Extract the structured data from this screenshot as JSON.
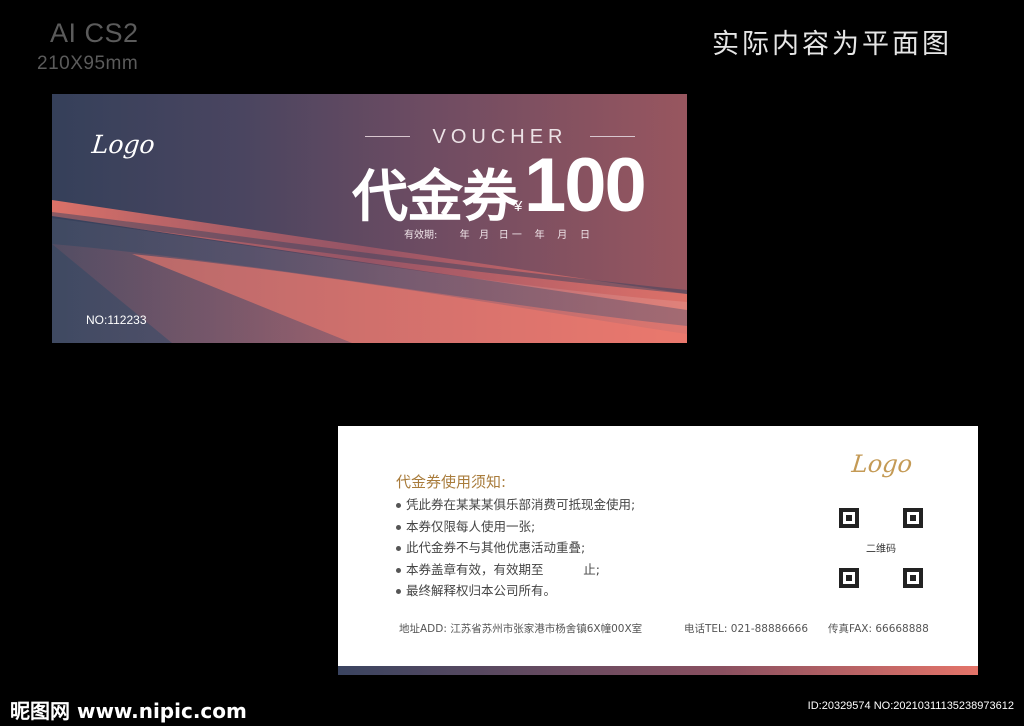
{
  "spec": {
    "software": "AI CS2",
    "size": "210X95mm"
  },
  "notice": "实际内容为平面图",
  "front": {
    "logo": "Logo",
    "voucher_word": "VOUCHER",
    "title_cn": "代金券",
    "currency": "¥",
    "amount": "100",
    "validity": "有效期:       年   月   日 一    年    月    日",
    "serial": "NO:112233",
    "colors": {
      "bg_left": "#35405a",
      "bg_right": "#98565f",
      "accent": "#e47469"
    }
  },
  "back": {
    "logo": "Logo",
    "rules_title": "代金券使用须知:",
    "rules": [
      "凭此券在某某某俱乐部消费可抵现金使用;",
      "本券仅限每人使用一张;",
      "此代金券不与其他优惠活动重叠;",
      "本券盖章有效，有效期至          止;",
      "最终解释权归本公司所有。"
    ],
    "qr_label": "二维码",
    "address": "地址ADD:  江苏省苏州市张家港市杨舍镇6X幢00X室",
    "phone": "电话TEL:  021-88886666",
    "fax": "传真FAX:  66668888",
    "colors": {
      "title": "#a97c3c",
      "logo": "#c49a55"
    }
  },
  "watermark": "昵图网 www.nipic.com",
  "image_id": "ID:20329574 NO:20210311135238973612"
}
